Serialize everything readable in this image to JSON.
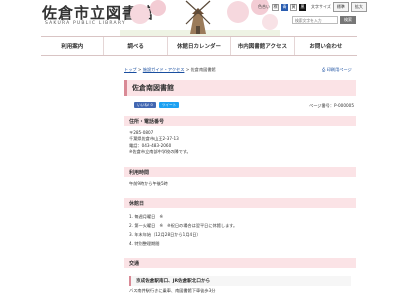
{
  "header": {
    "logo_title": "佐倉市立図書館",
    "logo_subtitle": "SAKURA PUBLIC LIBRARY",
    "color_label": "色合い",
    "color_options": [
      "標",
      "青",
      "黄",
      "黒"
    ],
    "font_label": "文字サイズ",
    "font_options": [
      "標準",
      "拡大"
    ],
    "search_placeholder": "検索文字を入力",
    "search_button": "検索"
  },
  "nav": {
    "items": [
      "利用案内",
      "調べる",
      "休館日カレンダー",
      "市内図書館アクセス",
      "お問い合わせ"
    ]
  },
  "breadcrumb": {
    "items": [
      "トップ",
      "施設ガイド・アクセス",
      "佐倉南図書館"
    ],
    "separator": " > ",
    "print_label": "印刷用ページ"
  },
  "page": {
    "title": "佐倉南図書館",
    "share_fb": "いいね! 0",
    "share_tw": "ツイート",
    "page_id": "ページ番号：P-000005"
  },
  "sections": {
    "address": {
      "heading": "住所・電話番号",
      "lines": [
        "〒285-0807",
        "千葉県佐倉市山王2-37-13",
        "電話：043-483-2060",
        "※佐倉市立南部中学校の隣です。"
      ]
    },
    "hours": {
      "heading": "利用時間",
      "lines": [
        "午前9時から午後5時"
      ]
    },
    "closed": {
      "heading": "休館日",
      "lines": [
        "1. 毎週月曜日　※",
        "2. 第一火曜日　※　※祝日の場合は翌平日に休館します。",
        "3. 年末年始（12月28日から1月4日）",
        "4. 特別整理期間"
      ]
    },
    "access": {
      "heading": "交通",
      "sub_heading": "京成佐倉駅南口、JR佐倉駅北口から",
      "lines": [
        "バス南井駅行きに乗車、南図書館下車徒歩3分"
      ]
    }
  },
  "colors": {
    "accent_pink": "#fbe3e6",
    "accent_border": "#d98a96",
    "link": "#1a4fa0"
  }
}
